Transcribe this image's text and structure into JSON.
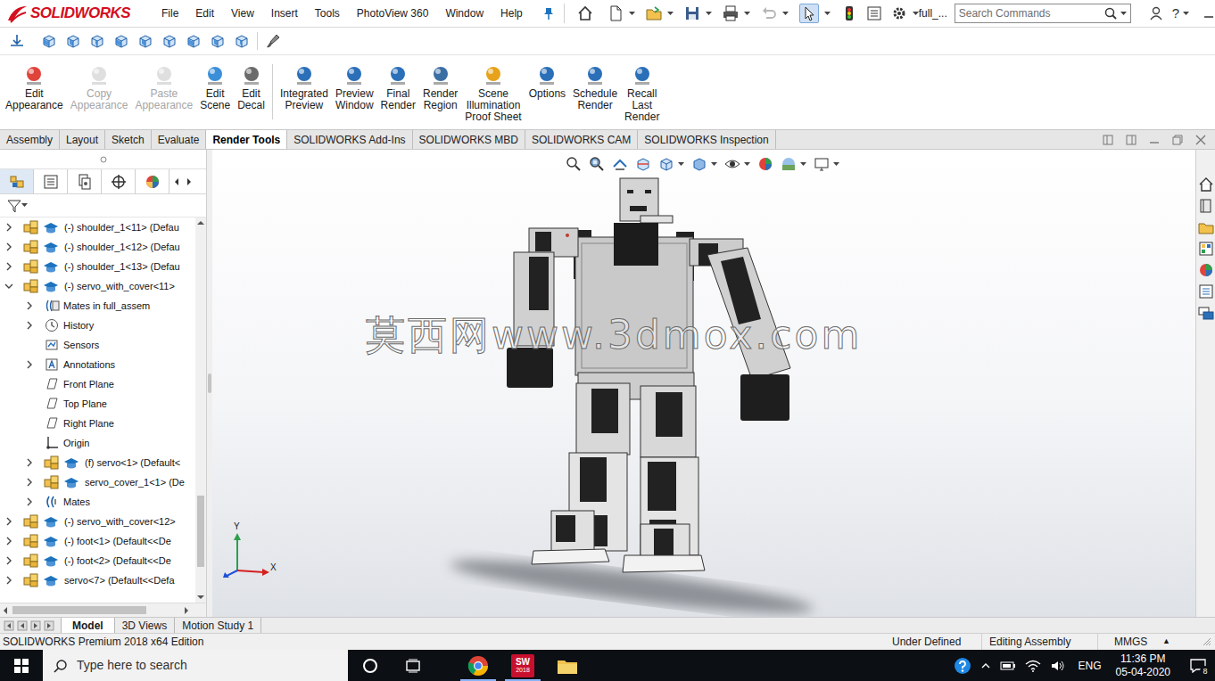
{
  "app": {
    "logo": "SOLIDWORKS",
    "document": "full_...",
    "help": "?"
  },
  "menu": [
    "File",
    "Edit",
    "View",
    "Insert",
    "Tools",
    "PhotoView 360",
    "Window",
    "Help"
  ],
  "quick_access": {
    "undo_disabled": true,
    "select_active": true
  },
  "search": {
    "placeholder": "Search Commands"
  },
  "ribbon": [
    {
      "lines": [
        "Edit",
        "Appearance"
      ],
      "disabled": false
    },
    {
      "lines": [
        "Copy",
        "Appearance"
      ],
      "disabled": true
    },
    {
      "lines": [
        "Paste",
        "Appearance"
      ],
      "disabled": true
    },
    {
      "lines": [
        "Edit",
        "Scene"
      ],
      "disabled": false
    },
    {
      "lines": [
        "Edit",
        "Decal"
      ],
      "disabled": false
    },
    {
      "lines": [
        "Integrated",
        "Preview"
      ],
      "disabled": false
    },
    {
      "lines": [
        "Preview",
        "Window"
      ],
      "disabled": false
    },
    {
      "lines": [
        "Final",
        "Render"
      ],
      "disabled": false
    },
    {
      "lines": [
        "Render",
        "Region"
      ],
      "disabled": false
    },
    {
      "lines": [
        "Scene",
        "Illumination",
        "Proof Sheet"
      ],
      "disabled": false
    },
    {
      "lines": [
        "Options"
      ],
      "disabled": false
    },
    {
      "lines": [
        "Schedule",
        "Render"
      ],
      "disabled": false
    },
    {
      "lines": [
        "Recall",
        "Last",
        "Render"
      ],
      "disabled": false
    }
  ],
  "tabs": [
    {
      "label": "Assembly",
      "selected": false
    },
    {
      "label": "Layout",
      "selected": false
    },
    {
      "label": "Sketch",
      "selected": false
    },
    {
      "label": "Evaluate",
      "selected": false
    },
    {
      "label": "Render Tools",
      "selected": true
    },
    {
      "label": "SOLIDWORKS Add-Ins",
      "selected": false
    },
    {
      "label": "SOLIDWORKS MBD",
      "selected": false
    },
    {
      "label": "SOLIDWORKS CAM",
      "selected": false
    },
    {
      "label": "SOLIDWORKS Inspection",
      "selected": false
    }
  ],
  "panel_tabs": [
    {
      "selected": true
    },
    {
      "selected": false
    },
    {
      "selected": false
    },
    {
      "selected": false
    },
    {
      "selected": false
    }
  ],
  "tree": {
    "items": [
      {
        "label": "(-) shoulder_1<11> (Defau",
        "depth": 0,
        "expander": "collapsed",
        "kind": "component"
      },
      {
        "label": "(-) shoulder_1<12> (Defau",
        "depth": 0,
        "expander": "collapsed",
        "kind": "component"
      },
      {
        "label": "(-) shoulder_1<13> (Defau",
        "depth": 0,
        "expander": "collapsed",
        "kind": "component"
      },
      {
        "label": "(-) servo_with_cover<11>",
        "depth": 0,
        "expander": "expanded",
        "kind": "component"
      },
      {
        "label": "Mates in full_assem",
        "depth": 1,
        "expander": "collapsed",
        "kind": "mates-folder"
      },
      {
        "label": "History",
        "depth": 1,
        "expander": "collapsed",
        "kind": "history"
      },
      {
        "label": "Sensors",
        "depth": 1,
        "expander": "none",
        "kind": "sensors"
      },
      {
        "label": "Annotations",
        "depth": 1,
        "expander": "collapsed",
        "kind": "annotations"
      },
      {
        "label": "Front Plane",
        "depth": 1,
        "expander": "none",
        "kind": "plane"
      },
      {
        "label": "Top Plane",
        "depth": 1,
        "expander": "none",
        "kind": "plane"
      },
      {
        "label": "Right Plane",
        "depth": 1,
        "expander": "none",
        "kind": "plane"
      },
      {
        "label": "Origin",
        "depth": 1,
        "expander": "none",
        "kind": "origin"
      },
      {
        "label": "(f) servo<1> (Default<",
        "depth": 1,
        "expander": "collapsed",
        "kind": "component"
      },
      {
        "label": "servo_cover_1<1> (De",
        "depth": 1,
        "expander": "collapsed",
        "kind": "component"
      },
      {
        "label": "Mates",
        "depth": 1,
        "expander": "collapsed",
        "kind": "mates"
      },
      {
        "label": "(-) servo_with_cover<12>",
        "depth": 0,
        "expander": "collapsed",
        "kind": "component"
      },
      {
        "label": "(-) foot<1> (Default<<De",
        "depth": 0,
        "expander": "collapsed",
        "kind": "component"
      },
      {
        "label": "(-) foot<2> (Default<<De",
        "depth": 0,
        "expander": "collapsed",
        "kind": "component"
      },
      {
        "label": "servo<7> (Default<<Defa",
        "depth": 0,
        "expander": "collapsed",
        "kind": "component"
      }
    ]
  },
  "watermark": "莫西网www.3dmox.com",
  "triad": {
    "y_label": "Y",
    "x_label": "X"
  },
  "view_tabs": [
    {
      "label": "Model",
      "selected": true
    },
    {
      "label": "3D Views",
      "selected": false
    },
    {
      "label": "Motion Study 1",
      "selected": false
    }
  ],
  "status_bar": {
    "edition": "SOLIDWORKS Premium 2018 x64 Edition",
    "state": "Under Defined",
    "mode": "Editing Assembly",
    "units": "MMGS",
    "units_arrow": "▲"
  },
  "taskbar": {
    "search_placeholder": "Type here to search",
    "apps": [
      {
        "kind": "chrome",
        "running": true
      },
      {
        "kind": "solidworks",
        "label": "SW",
        "badge": "2018",
        "running": true
      },
      {
        "kind": "explorer",
        "running": false
      }
    ],
    "language": "ENG",
    "time": "11:36 PM",
    "date": "05-04-2020",
    "notifications": "8"
  }
}
